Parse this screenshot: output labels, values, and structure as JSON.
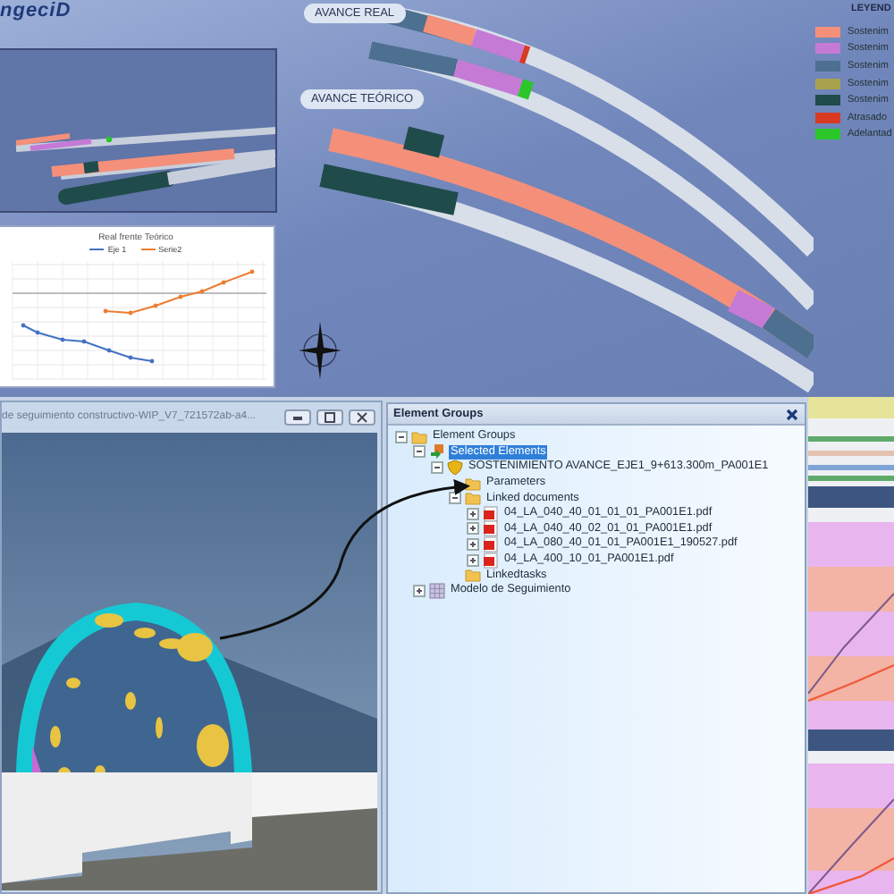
{
  "logo": "ngeciD",
  "view_labels": [
    "AVANCE REAL",
    "AVANCE TEÓRICO"
  ],
  "legend": {
    "title": "LEYEND",
    "items": [
      {
        "label": "Sostenim",
        "color": "#f4907a"
      },
      {
        "label": "Sostenim",
        "color": "#c57ad6"
      },
      {
        "label": "Sostenim",
        "color": "#4d6f90"
      },
      {
        "label": "Sostenim",
        "color": "#a9a24c"
      },
      {
        "label": "Sostenim",
        "color": "#1f4b4b"
      },
      {
        "label": "Atrasado",
        "color": "#d93a24"
      },
      {
        "label": "Adelantad",
        "color": "#2ac62a"
      }
    ]
  },
  "chart": {
    "title": "Real frente Teórico",
    "series": [
      {
        "name": "Eje 1",
        "color": "#4472c4"
      },
      {
        "name": "Serie2",
        "color": "#ed7d31"
      }
    ]
  },
  "viewer": {
    "title": "de seguimiento constructivo-WIP_V7_721572ab-a4..."
  },
  "element_groups": {
    "title": "Element Groups",
    "tree": [
      {
        "label": "Element Groups",
        "kind": "folder",
        "expanded": true,
        "selected": false,
        "children": [
          {
            "label": "Selected Elements",
            "kind": "selection",
            "expanded": true,
            "selected": true,
            "children": [
              {
                "label": "SOSTENIMIENTO AVANCE_EJE1_9+613.300m_PA001E1",
                "kind": "shield",
                "expanded": true,
                "selected": false,
                "children": [
                  {
                    "label": "Parameters",
                    "kind": "folder",
                    "selected": false
                  },
                  {
                    "label": "Linked documents",
                    "kind": "folder",
                    "expanded": true,
                    "selected": false,
                    "children": [
                      {
                        "label": "04_LA_040_40_01_01_01_PA001E1.pdf",
                        "kind": "pdf",
                        "expanded": false,
                        "selected": false
                      },
                      {
                        "label": "04_LA_040_40_02_01_01_PA001E1.pdf",
                        "kind": "pdf",
                        "expanded": false,
                        "selected": false
                      },
                      {
                        "label": "04_LA_080_40_01_01_PA001E1_190527.pdf",
                        "kind": "pdf",
                        "expanded": false,
                        "selected": false
                      },
                      {
                        "label": "04_LA_400_10_01_PA001E1.pdf",
                        "kind": "pdf",
                        "expanded": false,
                        "selected": false
                      }
                    ]
                  },
                  {
                    "label": "Linkedtasks",
                    "kind": "folder",
                    "selected": false
                  }
                ]
              }
            ]
          },
          {
            "label": "Modelo de Seguimiento",
            "kind": "model",
            "expanded": false,
            "selected": false
          }
        ]
      }
    ]
  }
}
